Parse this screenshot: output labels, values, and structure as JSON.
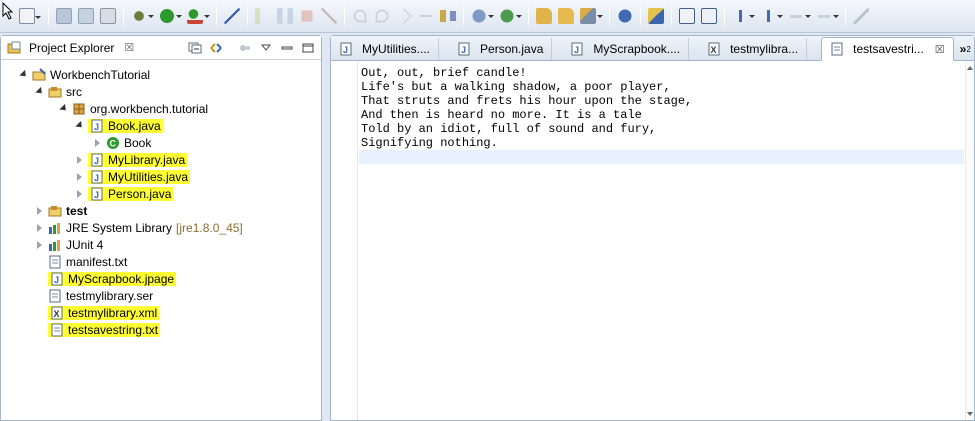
{
  "colors": {
    "highlight": "#ffff33",
    "current_line": "#e8f2fe",
    "panel_border": "#a5b4c8",
    "background": "#dfe7f2"
  },
  "toolbar": {
    "icons": [
      "new-icon",
      "save-icon",
      "save-all-icon",
      "print-icon",
      "debug-icon",
      "run-icon",
      "external-tools-icon",
      "skip-breakpoints-icon",
      "resume-icon",
      "suspend-icon",
      "terminate-icon",
      "disconnect-icon",
      "step-into-icon",
      "step-over-icon",
      "step-return-icon",
      "drop-to-frame-icon",
      "use-step-filters-icon",
      "new-java-project-icon",
      "new-package-icon",
      "new-class-icon",
      "open-type-icon",
      "open-task-icon",
      "search-icon",
      "toggle-mark-occurrences-icon",
      "toggle-block-selection-icon",
      "show-whitespace-icon",
      "next-annotation-icon",
      "previous-annotation-icon",
      "back-icon",
      "forward-icon",
      "pin-editor-icon"
    ]
  },
  "explorer": {
    "title": "Project Explorer",
    "close_glyph": "☒",
    "items": [
      {
        "label": "WorkbenchTutorial",
        "icon": "project-icon"
      },
      {
        "label": "src",
        "icon": "source-folder-icon"
      },
      {
        "label": "org.workbench.tutorial",
        "icon": "package-icon"
      },
      {
        "label": "Book.java",
        "icon": "java-file-icon"
      },
      {
        "label": "Book",
        "icon": "class-icon"
      },
      {
        "label": "MyLibrary.java",
        "icon": "java-file-icon"
      },
      {
        "label": "MyUtilities.java",
        "icon": "java-file-icon"
      },
      {
        "label": "Person.java",
        "icon": "java-file-icon"
      },
      {
        "label": "test",
        "icon": "source-folder-icon"
      },
      {
        "label": "JRE System Library",
        "decoration": "[jre1.8.0_45]",
        "icon": "library-icon"
      },
      {
        "label": "JUnit 4",
        "icon": "library-icon"
      },
      {
        "label": "manifest.txt",
        "icon": "text-file-icon"
      },
      {
        "label": "MyScrapbook.jpage",
        "icon": "scrapbook-icon"
      },
      {
        "label": "testmylibrary.ser",
        "icon": "text-file-icon"
      },
      {
        "label": "testmylibrary.xml",
        "icon": "xml-file-icon"
      },
      {
        "label": "testsavestring.txt",
        "icon": "text-file-icon"
      }
    ]
  },
  "editor": {
    "tabs": [
      {
        "label": "MyUtilities....",
        "icon": "java-file-icon"
      },
      {
        "label": "Person.java",
        "icon": "java-file-icon"
      },
      {
        "label": "MyScrapbook....",
        "icon": "scrapbook-icon"
      },
      {
        "label": "testmylibra...",
        "icon": "xml-file-icon"
      },
      {
        "label": "testsavestri...",
        "icon": "text-file-icon"
      }
    ],
    "overflow_label": "»",
    "overflow_count": "2",
    "lines": [
      "Out, out, brief candle!",
      "Life's but a walking shadow, a poor player,",
      "That struts and frets his hour upon the stage,",
      "And then is heard no more. It is a tale",
      "Told by an idiot, full of sound and fury,",
      "Signifying nothing.",
      ""
    ]
  }
}
